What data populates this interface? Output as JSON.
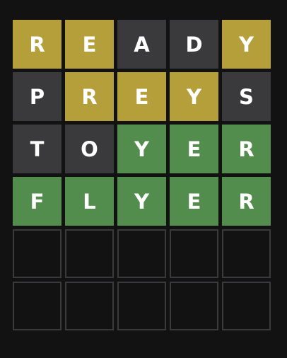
{
  "board": {
    "rows": [
      [
        {
          "letter": "R",
          "state": "present"
        },
        {
          "letter": "E",
          "state": "present"
        },
        {
          "letter": "A",
          "state": "absent"
        },
        {
          "letter": "D",
          "state": "absent"
        },
        {
          "letter": "Y",
          "state": "present"
        }
      ],
      [
        {
          "letter": "P",
          "state": "absent"
        },
        {
          "letter": "R",
          "state": "present"
        },
        {
          "letter": "E",
          "state": "present"
        },
        {
          "letter": "Y",
          "state": "present"
        },
        {
          "letter": "S",
          "state": "absent"
        }
      ],
      [
        {
          "letter": "T",
          "state": "absent"
        },
        {
          "letter": "O",
          "state": "absent"
        },
        {
          "letter": "Y",
          "state": "correct"
        },
        {
          "letter": "E",
          "state": "correct"
        },
        {
          "letter": "R",
          "state": "correct"
        }
      ],
      [
        {
          "letter": "F",
          "state": "correct"
        },
        {
          "letter": "L",
          "state": "correct"
        },
        {
          "letter": "Y",
          "state": "correct"
        },
        {
          "letter": "E",
          "state": "correct"
        },
        {
          "letter": "R",
          "state": "correct"
        }
      ],
      [
        {
          "letter": "",
          "state": "empty"
        },
        {
          "letter": "",
          "state": "empty"
        },
        {
          "letter": "",
          "state": "empty"
        },
        {
          "letter": "",
          "state": "empty"
        },
        {
          "letter": "",
          "state": "empty"
        }
      ],
      [
        {
          "letter": "",
          "state": "empty"
        },
        {
          "letter": "",
          "state": "empty"
        },
        {
          "letter": "",
          "state": "empty"
        },
        {
          "letter": "",
          "state": "empty"
        },
        {
          "letter": "",
          "state": "empty"
        }
      ]
    ]
  },
  "colors": {
    "background": "#121213",
    "present": "#b59f3b",
    "absent": "#3a3a3c",
    "correct": "#538d4e",
    "empty_border": "#3a3a3c",
    "letter": "#ffffff"
  }
}
